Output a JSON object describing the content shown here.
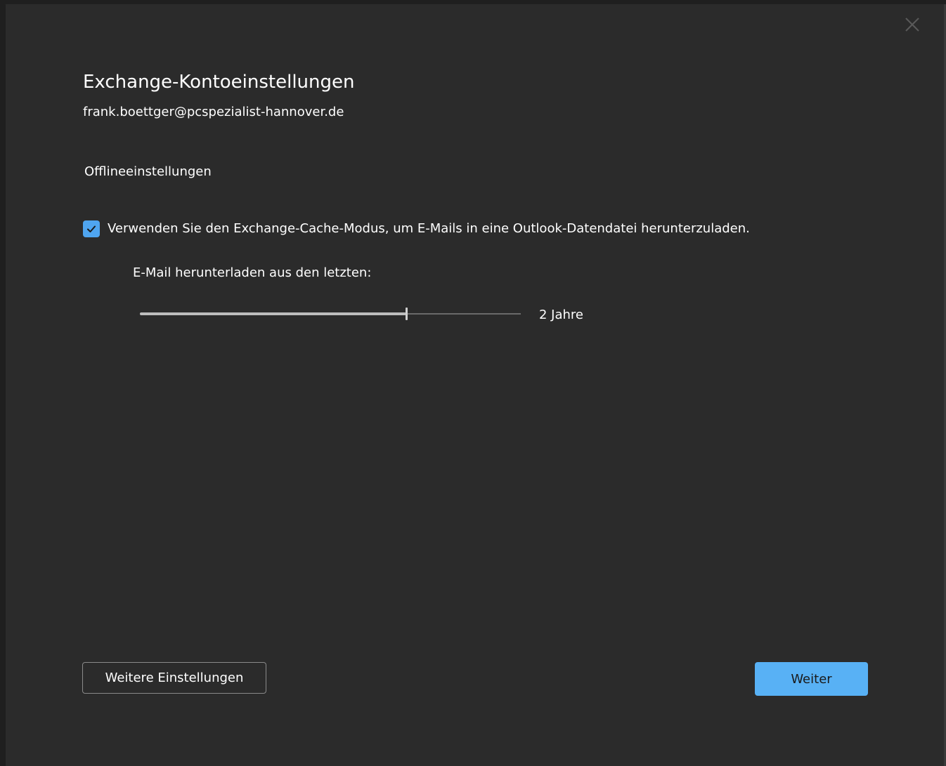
{
  "dialog": {
    "title": "Exchange-Kontoeinstellungen",
    "account_email": "frank.boettger@pcspezialist-hannover.de",
    "close_icon": "close-icon"
  },
  "offline": {
    "section_title": "Offlineeinstellungen",
    "cache_mode": {
      "checked": true,
      "label": "Verwenden Sie den Exchange-Cache-Modus, um E-Mails in eine Outlook-Datendatei herunterzuladen."
    },
    "download_period": {
      "label": "E-Mail herunterladen aus den letzten:",
      "value_text": "2 Jahre",
      "level_fraction": 0.7
    }
  },
  "buttons": {
    "more_settings": "Weitere Einstellungen",
    "next": "Weiter"
  },
  "colors": {
    "background": "#2b2b2b",
    "accent": "#58b1f5",
    "checkbox": "#4fa5f0",
    "text": "#ffffff"
  }
}
